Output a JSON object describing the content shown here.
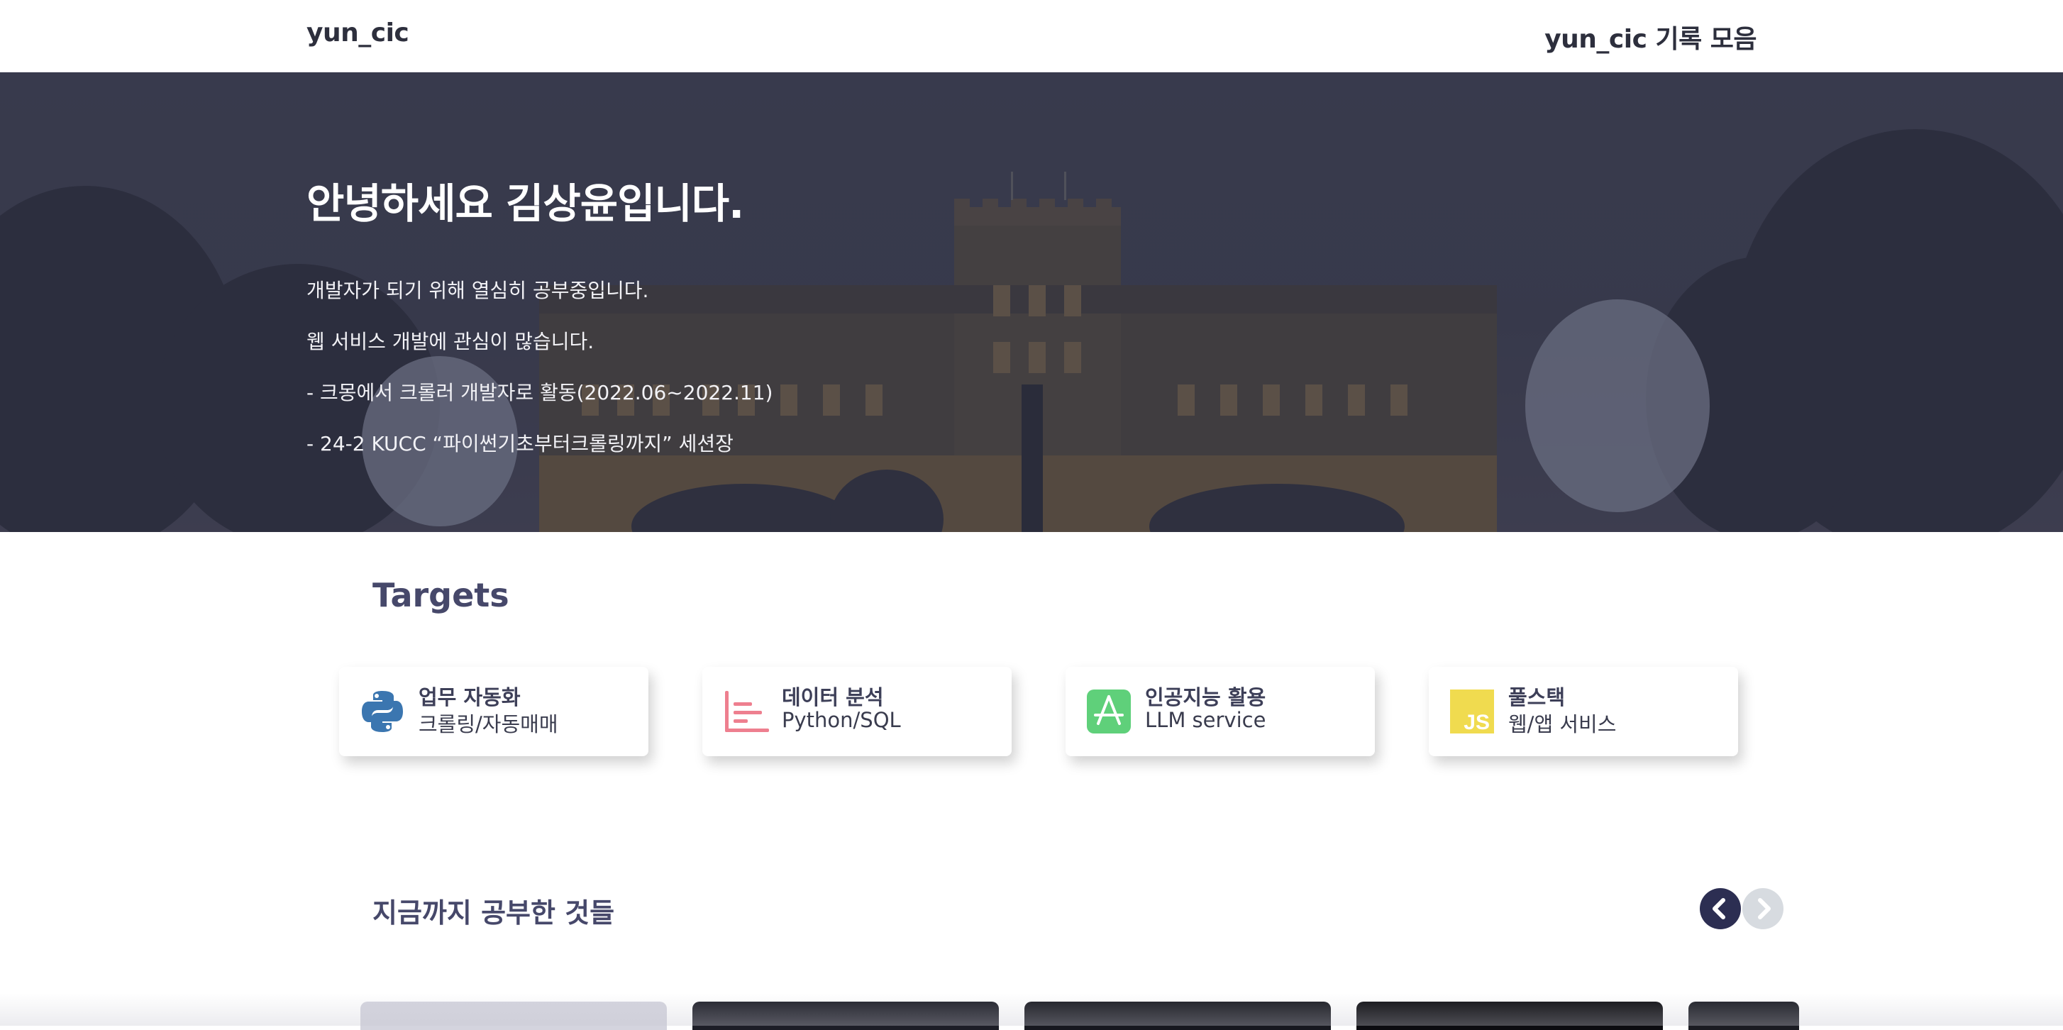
{
  "header": {
    "brand": "yun_cic",
    "nav_link": "yun_cic 기록 모음"
  },
  "hero": {
    "title": "안녕하세요 김상윤입니다.",
    "lines": [
      "개발자가 되기 위해 열심히 공부중입니다.",
      "웹 서비스 개발에 관심이 많습니다.",
      "- 크몽에서 크롤러 개발자로 활동(2022.06~2022.11)",
      "- 24-2 KUCC “파이썬기초부터크롤링까지” 세션장"
    ]
  },
  "targets": {
    "title": "Targets",
    "cards": [
      {
        "icon": "python-icon",
        "title": "업무 자동화",
        "subtitle": "크롤링/자동매매"
      },
      {
        "icon": "chart-icon",
        "title": "데이터 분석",
        "subtitle": "Python/SQL"
      },
      {
        "icon": "app-store-icon",
        "title": "인공지능 활용",
        "subtitle": "LLM service"
      },
      {
        "icon": "javascript-icon",
        "title": "풀스택",
        "subtitle": "웹/앱 서비스"
      }
    ]
  },
  "studied": {
    "title": "지금까지 공부한 것들"
  },
  "colors": {
    "accent_dark": "#2c2e52",
    "heading": "#46486a",
    "python_blue": "#3b76b0",
    "python_yellow": "#f2c94c",
    "chart_pink": "#ee7f8f",
    "app_green": "#5fd07a",
    "js_yellow": "#f0db4f"
  }
}
